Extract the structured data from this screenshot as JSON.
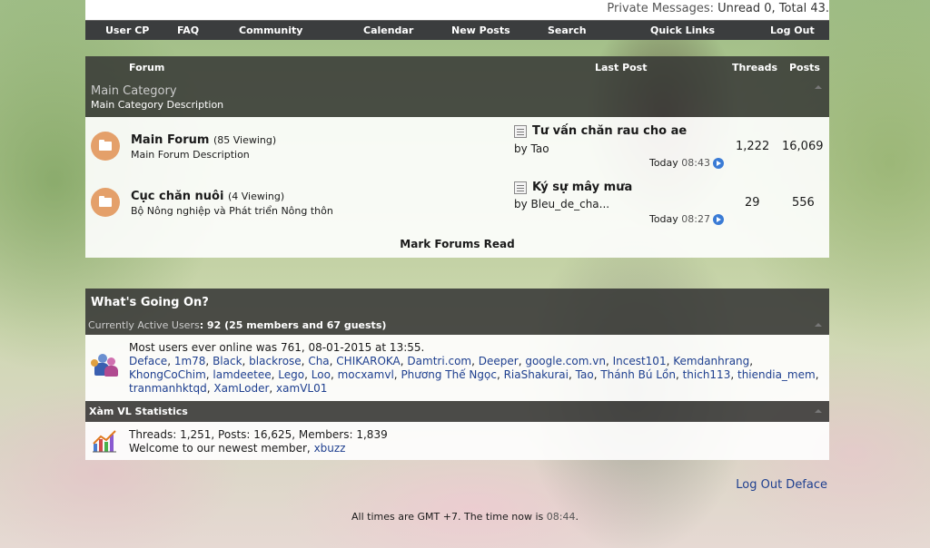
{
  "header": {
    "pm_label": "Private Messages:",
    "pm_status": "Unread 0, Total 43."
  },
  "navbar": {
    "items": [
      "User CP",
      "FAQ",
      "Community",
      "Calendar",
      "New Posts",
      "Search",
      "Quick Links",
      "Log Out"
    ]
  },
  "forum_table": {
    "columns": {
      "forum": "Forum",
      "last_post": "Last Post",
      "threads": "Threads",
      "posts": "Posts"
    },
    "category": {
      "title": "Main Category",
      "description": "Main Category Description"
    },
    "forums": [
      {
        "title": "Main Forum",
        "viewing": "(85 Viewing)",
        "description": "Main Forum Description",
        "last_post_title": "Tư vấn chăn rau cho ae",
        "last_post_by_label": "by",
        "last_post_by": "Tao",
        "last_post_day": "Today",
        "last_post_time": "08:43",
        "threads": "1,222",
        "posts": "16,069"
      },
      {
        "title": "Cục chăn nuôi",
        "viewing": "(4 Viewing)",
        "description": "Bộ Nông nghiệp và Phát triển Nông thôn",
        "last_post_title": "Ký sự mây mưa",
        "last_post_by_label": "by",
        "last_post_by": "Bleu_de_cha...",
        "last_post_day": "Today",
        "last_post_time": "08:27",
        "threads": "29",
        "posts": "556"
      }
    ],
    "mark_read": "Mark Forums Read"
  },
  "whats_going_on": {
    "title": "What's Going On?",
    "active_label": "Currently Active Users",
    "active_count": ": 92 (25 members and 67 guests)",
    "most_online": "Most users ever online was 761, 08-01-2015 at 13:55.",
    "users": [
      "Deface",
      "1m78",
      "Black",
      "blackrose",
      "Cha",
      "CHIKAROKA",
      "Damtri.com",
      "Deeper",
      "google.com.vn",
      "Incest101",
      "Kemdanhrang",
      "KhongCoChim",
      "lamdeetee",
      "Lego",
      "Loo",
      "mocxamvl",
      "Phương Thế Ngọc",
      "RiaShakurai",
      "Tao",
      "Thánh Bú Lồn",
      "thich113",
      "thiendia_mem",
      "tranmanhktqd",
      "XamLoder",
      "xamVL01"
    ]
  },
  "statistics": {
    "title": "Xàm VL Statistics",
    "summary": "Threads: 1,251, Posts: 16,625, Members: 1,839",
    "welcome": "Welcome to our newest member,",
    "newest_member": "xbuzz"
  },
  "footer": {
    "logout_deface": "Log Out Deface",
    "time_prefix": "All times are GMT +7. The time now is",
    "time_now": "08:44",
    "time_suffix": "."
  },
  "colors": {
    "header_bg": "#3b3d3e",
    "link": "#1e3f8f",
    "folder_icon": "#e4a06a",
    "go_icon": "#3a7bd5"
  }
}
